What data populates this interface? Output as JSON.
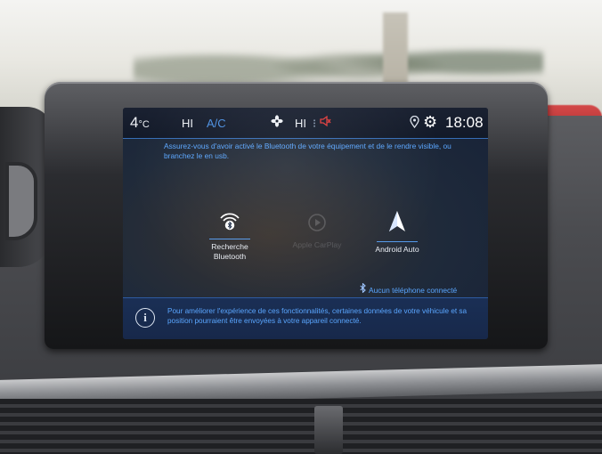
{
  "statusbar": {
    "temperature_value": "4",
    "temperature_unit": "°C",
    "fan_left_level": "HI",
    "ac_label": "A/C",
    "fan_icon": "fan-icon",
    "fan_right_level": "HI",
    "mute_icon": "speaker-mute-icon",
    "location_icon": "location-pin-icon",
    "settings_icon": "gear-icon",
    "time": "18:08"
  },
  "connect": {
    "instruction": "Assurez-vous d'avoir activé le Bluetooth de votre équipement et de le rendre visible, ou branchez le en usb.",
    "bluetooth_option": {
      "line1": "Recherche",
      "line2": "Bluetooth"
    },
    "carplay_option": {
      "label": "Apple CarPlay"
    },
    "android_option": {
      "label": "Android Auto"
    },
    "phone_status": "Aucun téléphone connecté"
  },
  "info": {
    "text": "Pour améliorer l'expérience de ces fonctionnalités, certaines données de votre véhicule et sa position pourraient être envoyées à votre appareil connecté."
  },
  "colors": {
    "accent_blue": "#5aa6ff",
    "ac_blue": "#4b8fe0",
    "mute_red": "#e23b3b"
  }
}
